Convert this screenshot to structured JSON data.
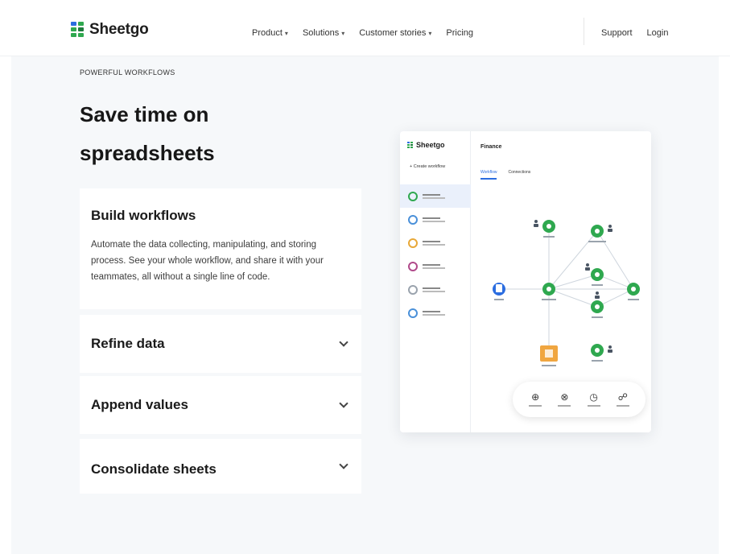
{
  "header": {
    "brand": "Sheetgo",
    "nav": [
      {
        "label": "Product"
      },
      {
        "label": "Solutions"
      },
      {
        "label": "Customer stories"
      },
      {
        "label": "Pricing"
      }
    ],
    "support_label": "Support",
    "login_label": "Login"
  },
  "hero": {
    "eyebrow": "POWERFUL WORKFLOWS",
    "title": "Save time on spreadsheets"
  },
  "accordion": [
    {
      "title": "Build workflows",
      "body": "Automate the data collecting, manipulating, and storing process. See your whole workflow, and share it with your teammates, all without a single line of code.",
      "expanded": true
    },
    {
      "title": "Refine data",
      "expanded": false
    },
    {
      "title": "Append values",
      "expanded": false
    },
    {
      "title": "Consolidate sheets",
      "expanded": false
    }
  ],
  "app_preview": {
    "brand": "Sheetgo",
    "create_label": "+ Create workflow",
    "main_title": "Finance",
    "tabs": [
      {
        "label": "Workflow",
        "active": true
      },
      {
        "label": "Connections",
        "active": false
      }
    ],
    "sidebar_icon_colors": [
      "#2fa84f",
      "#4a90d9",
      "#e8a838",
      "#b04a8a",
      "#9aa3ad",
      "#4a90d9"
    ],
    "toolbar_icons": [
      "connect-icon",
      "filter-icon",
      "schedule-icon",
      "share-icon"
    ]
  },
  "colors": {
    "logo_green": "#2fa84f",
    "logo_dark_green": "#1e7a3c",
    "logo_blue": "#2b6de0",
    "node_green": "#2fa84f",
    "node_blue": "#2b6de0",
    "node_orange": "#f0a640",
    "hero_bg": "#f6f8fa"
  }
}
